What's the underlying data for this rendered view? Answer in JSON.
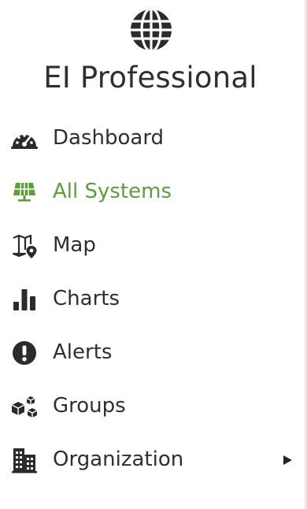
{
  "brand": {
    "title": "EI Professional",
    "logo_icon": "globe-icon"
  },
  "theme": {
    "text_color": "#2f2f2f",
    "icon_color": "#2b2b2b",
    "active_color": "#5c9e3a"
  },
  "nav": {
    "items": [
      {
        "label": "Dashboard",
        "icon": "speedometer-icon",
        "active": false
      },
      {
        "label": "All Systems",
        "icon": "solar-panel-icon",
        "active": true
      },
      {
        "label": "Map",
        "icon": "map-marker-icon",
        "active": false
      },
      {
        "label": "Charts",
        "icon": "bar-chart-icon",
        "active": false
      },
      {
        "label": "Alerts",
        "icon": "exclamation-circle-icon",
        "active": false
      },
      {
        "label": "Groups",
        "icon": "cubes-icon",
        "active": false
      },
      {
        "label": "Organization",
        "icon": "building-icon",
        "active": false,
        "has_submenu": true
      }
    ]
  }
}
